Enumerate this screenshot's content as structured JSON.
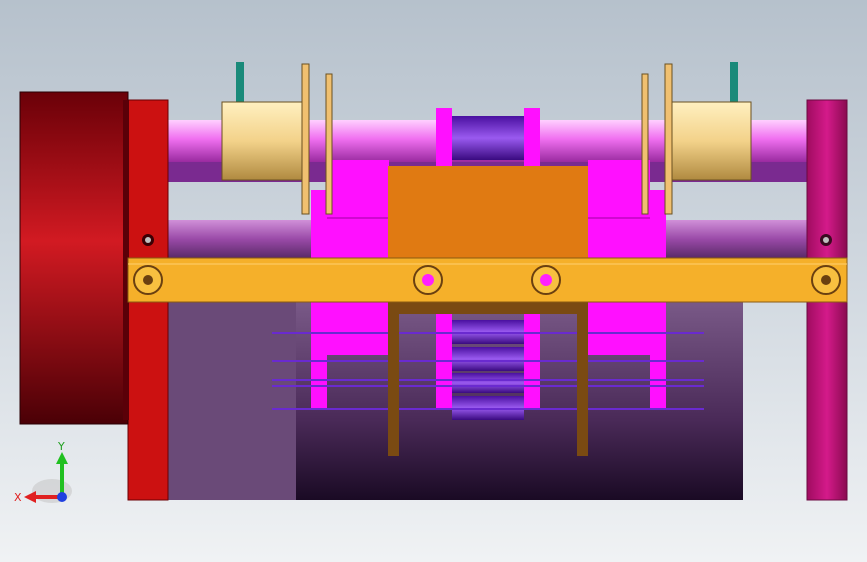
{
  "viewport": {
    "background_top": "#b6c1cc",
    "background_bottom": "#f0f2f4"
  },
  "model": {
    "parts": [
      {
        "name": "motor",
        "color": "#b0101a"
      },
      {
        "name": "left-end-plate",
        "color": "#cc1111"
      },
      {
        "name": "right-end-plate",
        "color": "#c0157a"
      },
      {
        "name": "upper-shaft",
        "color": "#f080f0"
      },
      {
        "name": "lower-shaft",
        "color": "#a050b0"
      },
      {
        "name": "bushings",
        "color": "#f3d28a"
      },
      {
        "name": "cam-discs",
        "color": "#f0c070"
      },
      {
        "name": "magenta-blocks",
        "color": "#ff10ff"
      },
      {
        "name": "center-block",
        "color": "#e07a12"
      },
      {
        "name": "cross-beam",
        "color": "#f5b02a"
      },
      {
        "name": "brown-frame",
        "color": "#7a4a12"
      },
      {
        "name": "purple-rollers",
        "color": "#7a30e0"
      },
      {
        "name": "base-box",
        "color": "#6a4a7a"
      },
      {
        "name": "teal-posts",
        "color": "#1a8a7a"
      }
    ]
  },
  "triad": {
    "x_label": "X",
    "y_label": "Y",
    "x_color": "#e02020",
    "y_color": "#20c020",
    "z_color": "#2040e0"
  }
}
